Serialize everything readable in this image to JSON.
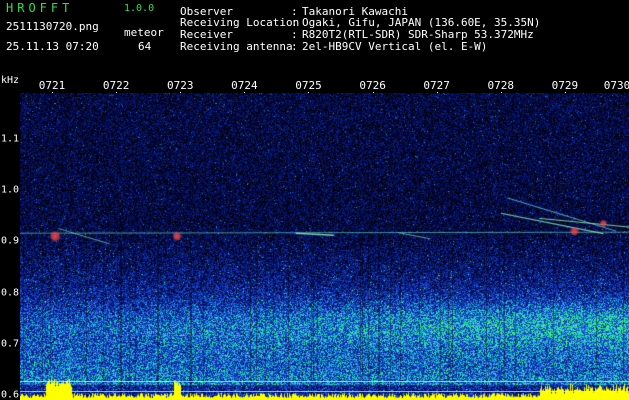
{
  "app": {
    "title": "HROFFT",
    "version": "1.0.0"
  },
  "header": {
    "filename": "2511130720.png",
    "meteor_label": "meteor",
    "datetime": "25.11.13 07:20",
    "meteor_count": "64",
    "info": [
      {
        "label": "Observer",
        "value": "Takanori Kawachi"
      },
      {
        "label": "Receiving Location",
        "value": "Ogaki, Gifu, JAPAN (136.60E, 35.35N)"
      },
      {
        "label": "Receiver",
        "value": "R820T2(RTL-SDR) SDR-Sharp 53.372MHz"
      },
      {
        "label": "Receiving antenna",
        "value": "2el-HB9CV Vertical (el. E-W)"
      }
    ]
  },
  "chart_data": {
    "type": "heatmap",
    "title": "",
    "xlabel": "",
    "ylabel": "kHz",
    "x_ticks": [
      "0721",
      "0722",
      "0723",
      "0724",
      "0725",
      "0726",
      "0727",
      "0728",
      "0729",
      "0730"
    ],
    "y_ticks": [
      1.1,
      1.0,
      0.9,
      0.8,
      0.7,
      0.6
    ],
    "ylim": [
      0.59,
      1.19
    ],
    "xlim_minutes": [
      20.5,
      30.0
    ],
    "reference_lines_khz": [
      0.628,
      0.608
    ],
    "colors": {
      "background": "#000000",
      "noise_low": "#06126b",
      "noise_mid": "#1d4fe0",
      "noise_high": "#1fd7d0",
      "trace_green": "#46ff5a",
      "hot_red": "#ff3a3a",
      "spectrum_bar": "#ffff00"
    }
  }
}
